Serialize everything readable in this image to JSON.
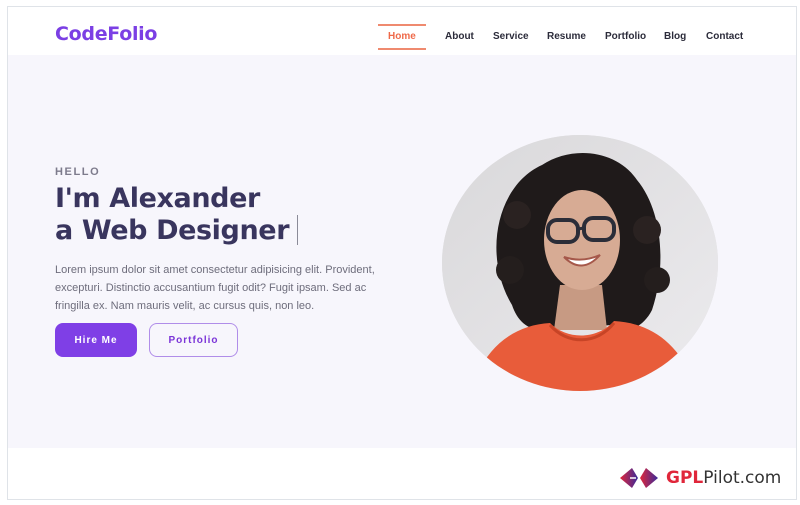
{
  "header": {
    "logo": "CodeFolio",
    "nav": [
      {
        "label": "Home",
        "active": true
      },
      {
        "label": "About",
        "active": false
      },
      {
        "label": "Service",
        "active": false
      },
      {
        "label": "Resume",
        "active": false
      },
      {
        "label": "Portfolio",
        "active": false
      },
      {
        "label": "Blog",
        "active": false
      },
      {
        "label": "Contact",
        "active": false
      }
    ]
  },
  "hero": {
    "greeting": "HELLO",
    "title_prefix": "I'm",
    "name": "Alexander",
    "role_article": "a",
    "role": "Web Designer",
    "description": "Lorem ipsum dolor sit amet consectetur adipisicing elit. Provident, excepturi. Distinctio accusantium fugit odit? Fugit ipsam. Sed ac fringilla ex. Nam mauris velit, ac cursus quis, non leo.",
    "primary_button": "Hire Me",
    "secondary_button": "Portfolio",
    "portrait_alt": "Smiling woman with curly hair and glasses in an orange top"
  },
  "watermark": {
    "brand_bold": "GPL",
    "brand_rest": "Pilot.com"
  },
  "colors": {
    "brand": "#7b3fe4",
    "active_nav": "#ef6a4a",
    "hero_bg": "#f7f6fc",
    "heading": "#39355e"
  }
}
